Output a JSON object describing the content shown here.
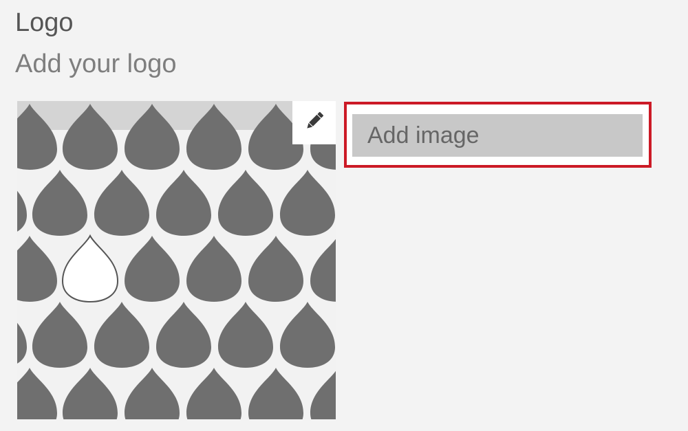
{
  "section": {
    "title": "Logo",
    "subtitle": "Add your logo"
  },
  "logo": {
    "pattern_color": "#6f6f6f",
    "background_color": "#f2f2f2",
    "band_color": "#d4d4d4"
  },
  "edit": {
    "icon": "pencil-icon"
  },
  "menu": {
    "items": [
      {
        "label": "Add image"
      }
    ],
    "highlight_color": "#cc1a26"
  }
}
